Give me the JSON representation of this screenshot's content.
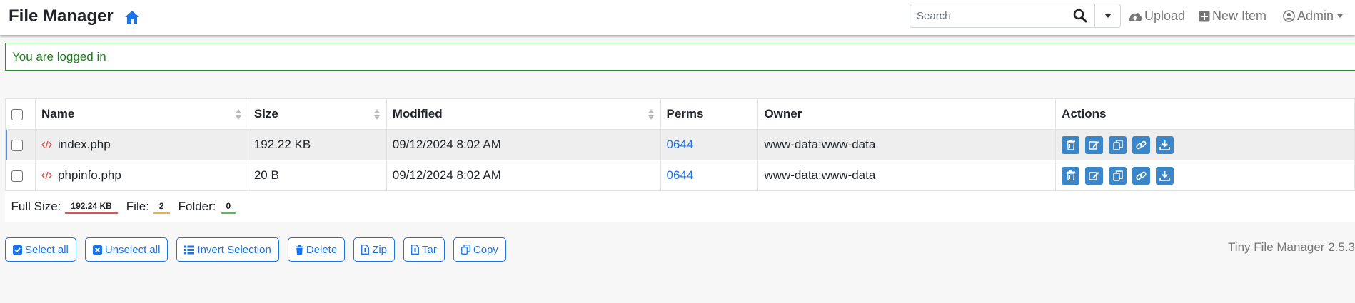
{
  "header": {
    "brand": "File Manager",
    "search_placeholder": "Search",
    "upload_label": "Upload",
    "new_item_label": "New Item",
    "admin_label": "Admin"
  },
  "alert": {
    "message": "You are logged in"
  },
  "table": {
    "columns": [
      "Name",
      "Size",
      "Modified",
      "Perms",
      "Owner",
      "Actions"
    ],
    "rows": [
      {
        "name": "index.php",
        "size": "192.22 KB",
        "modified": "09/12/2024 8:02 AM",
        "perms": "0644",
        "owner": "www-data:www-data"
      },
      {
        "name": "phpinfo.php",
        "size": "20 B",
        "modified": "09/12/2024 8:02 AM",
        "perms": "0644",
        "owner": "www-data:www-data"
      }
    ],
    "row_actions": [
      "trash-icon",
      "edit-icon",
      "copy-icon",
      "link-icon",
      "download-icon"
    ],
    "footer": {
      "full_size_label": "Full Size:",
      "full_size_value": "192.24 KB",
      "file_label": "File:",
      "file_count": "2",
      "folder_label": "Folder:",
      "folder_count": "0"
    }
  },
  "bulk_actions": {
    "select_all": "Select all",
    "unselect_all": "Unselect all",
    "invert_selection": "Invert Selection",
    "delete": "Delete",
    "zip": "Zip",
    "tar": "Tar",
    "copy": "Copy"
  },
  "version": "Tiny File Manager 2.5.3",
  "colors": {
    "accent": "#1a73e8",
    "action_button": "#3a86c8",
    "success": "#2e8b2e",
    "file_icon": "#d9534f"
  }
}
